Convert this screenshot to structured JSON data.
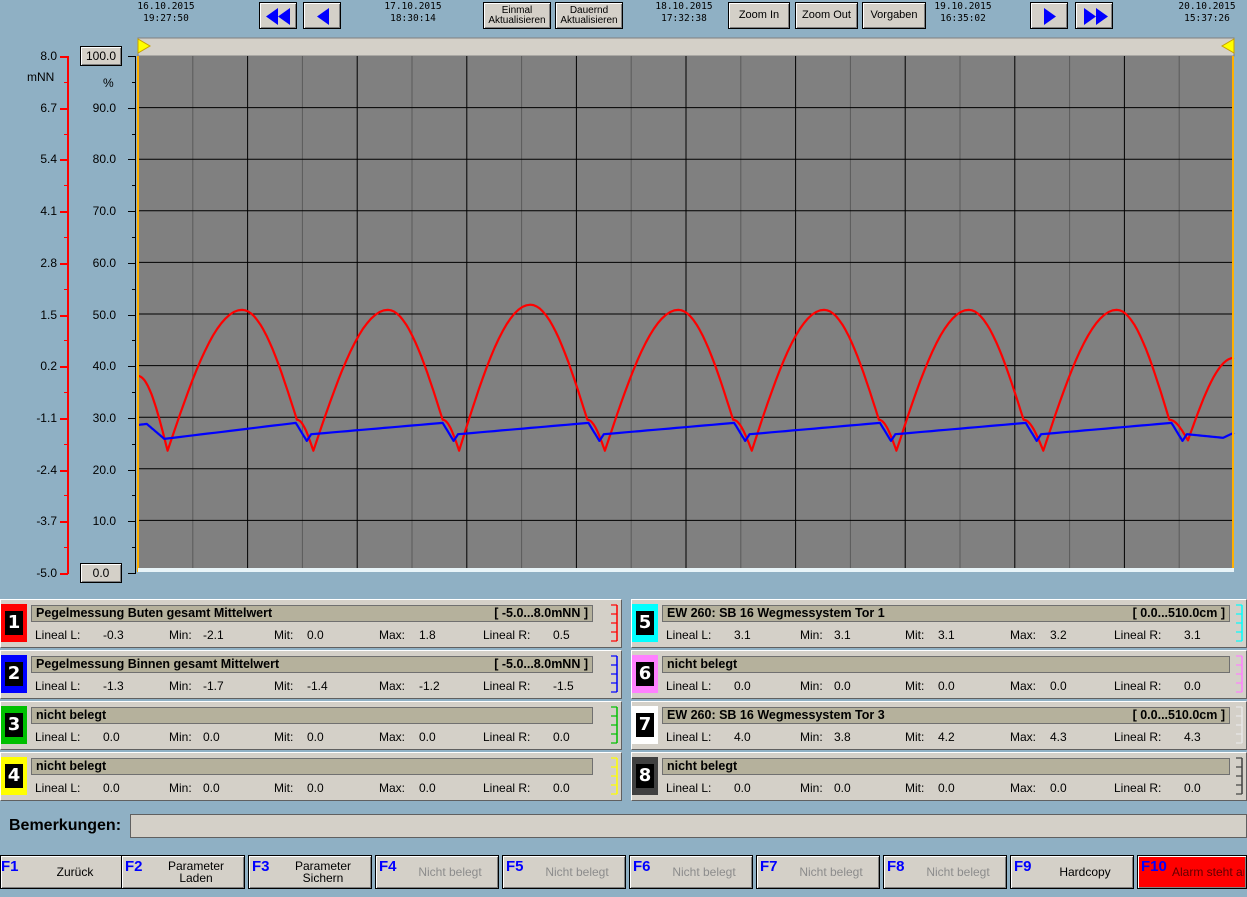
{
  "timeline": [
    {
      "date": "16.10.2015",
      "time": "19:27:50"
    },
    {
      "date": "17.10.2015",
      "time": "18:30:14"
    },
    {
      "date": "18.10.2015",
      "time": "17:32:38"
    },
    {
      "date": "19.10.2015",
      "time": "16:35:02"
    },
    {
      "date": "20.10.2015",
      "time": "15:37:26"
    }
  ],
  "toolbar": {
    "einmal": "Einmal\nAktualisieren",
    "dauernd": "Dauernd\nAktualisieren",
    "zoom_in": "Zoom In",
    "zoom_out": "Zoom Out",
    "vorgaben": "Vorgaben"
  },
  "left_axis": {
    "unit": "mNN",
    "ticks": [
      "8.0",
      "6.7",
      "5.4",
      "4.1",
      "2.8",
      "1.5",
      "0.2",
      "-1.1",
      "-2.4",
      "-3.7",
      "-5.0"
    ]
  },
  "pct_axis": {
    "unit": "%",
    "max_box": "100.0",
    "min_box": "0.0",
    "ticks": [
      "90.0",
      "80.0",
      "70.0",
      "60.0",
      "50.0",
      "40.0",
      "30.0",
      "20.0",
      "10.0"
    ]
  },
  "chart_data": {
    "type": "line",
    "xlim": [
      "16.10.2015 19:27:50",
      "20.10.2015 15:37:26"
    ],
    "ylim": [
      0,
      100
    ],
    "ylabel": "%",
    "grid": true,
    "series": [
      {
        "name": "Pegelmessung Buten gesamt Mittelwert",
        "color": "#ff0000",
        "x": [
          0,
          0.027,
          0.095,
          0.145,
          0.16,
          0.228,
          0.278,
          0.293,
          0.358,
          0.41,
          0.426,
          0.493,
          0.543,
          0.56,
          0.626,
          0.676,
          0.692,
          0.758,
          0.808,
          0.826,
          0.893,
          0.941,
          0.958,
          1.0
        ],
        "y": [
          38,
          23.5,
          50.8,
          29.5,
          23.5,
          50.8,
          29.5,
          23.5,
          51.8,
          29.5,
          23.5,
          50.8,
          29.5,
          23.5,
          50.8,
          29.5,
          23.5,
          50.8,
          29.5,
          23.5,
          50.8,
          29.5,
          25.5,
          41.5
        ]
      },
      {
        "name": "Pegelmessung Binnen gesamt Mittelwert",
        "color": "#0000ff",
        "x": [
          0,
          0.008,
          0.024,
          0.144,
          0.154,
          0.158,
          0.278,
          0.288,
          0.292,
          0.411,
          0.421,
          0.425,
          0.544,
          0.554,
          0.558,
          0.677,
          0.687,
          0.691,
          0.81,
          0.82,
          0.824,
          0.943,
          0.953,
          0.957,
          0.99,
          1.0
        ],
        "y": [
          28.5,
          28.7,
          25.8,
          28.9,
          25.4,
          26.7,
          28.9,
          25.4,
          26.7,
          28.9,
          25.4,
          26.7,
          28.9,
          25.4,
          26.7,
          28.9,
          25.4,
          26.7,
          28.9,
          25.4,
          26.7,
          28.9,
          25.4,
          26.7,
          26.0,
          27.0
        ]
      }
    ]
  },
  "channels": [
    {
      "num": "1",
      "color": "#ff0000",
      "name": "Pegelmessung Buten gesamt Mittelwert",
      "range": "[ -5.0...8.0mNN ]",
      "lineal_l": "-0.3",
      "min": "-2.1",
      "mit": "0.0",
      "max": "1.8",
      "lineal_r": "0.5"
    },
    {
      "num": "2",
      "color": "#0000ff",
      "name": "Pegelmessung Binnen gesamt Mittelwert",
      "range": "[ -5.0...8.0mNN ]",
      "lineal_l": "-1.3",
      "min": "-1.7",
      "mit": "-1.4",
      "max": "-1.2",
      "lineal_r": "-1.5"
    },
    {
      "num": "3",
      "color": "#00c000",
      "name": "nicht belegt",
      "range": "",
      "lineal_l": "0.0",
      "min": "0.0",
      "mit": "0.0",
      "max": "0.0",
      "lineal_r": "0.0"
    },
    {
      "num": "4",
      "color": "#ffff00",
      "name": "nicht belegt",
      "range": "",
      "lineal_l": "0.0",
      "min": "0.0",
      "mit": "0.0",
      "max": "0.0",
      "lineal_r": "0.0"
    },
    {
      "num": "5",
      "color": "#00ffff",
      "name": "EW 260: SB 16 Wegmessystem Tor 1",
      "range": "[ 0.0...510.0cm ]",
      "lineal_l": "3.1",
      "min": "3.1",
      "mit": "3.1",
      "max": "3.2",
      "lineal_r": "3.1"
    },
    {
      "num": "6",
      "color": "#ff80ff",
      "name": "nicht belegt",
      "range": "",
      "lineal_l": "0.0",
      "min": "0.0",
      "mit": "0.0",
      "max": "0.0",
      "lineal_r": "0.0"
    },
    {
      "num": "7",
      "color": "#ffffff",
      "name": "EW 260: SB 16 Wegmessystem Tor 3",
      "range": "[ 0.0...510.0cm ]",
      "lineal_l": "4.0",
      "min": "3.8",
      "mit": "4.2",
      "max": "4.3",
      "lineal_r": "4.3"
    },
    {
      "num": "8",
      "color": "#404040",
      "name": "nicht belegt",
      "range": "",
      "lineal_l": "0.0",
      "min": "0.0",
      "mit": "0.0",
      "max": "0.0",
      "lineal_r": "0.0"
    }
  ],
  "stat_labels": {
    "lineal_l": "Lineal L:",
    "min": "Min:",
    "mit": "Mit:",
    "max": "Max:",
    "lineal_r": "Lineal R:"
  },
  "remarks": {
    "label": "Bemerkungen:",
    "value": ""
  },
  "fkeys": [
    {
      "key": "F1",
      "label": "Zurück",
      "enabled": true
    },
    {
      "key": "F2",
      "label": "Parameter\nLaden",
      "enabled": true
    },
    {
      "key": "F3",
      "label": "Parameter\nSichern",
      "enabled": true
    },
    {
      "key": "F4",
      "label": "Nicht belegt",
      "enabled": false
    },
    {
      "key": "F5",
      "label": "Nicht belegt",
      "enabled": false
    },
    {
      "key": "F6",
      "label": "Nicht belegt",
      "enabled": false
    },
    {
      "key": "F7",
      "label": "Nicht belegt",
      "enabled": false
    },
    {
      "key": "F8",
      "label": "Nicht belegt",
      "enabled": false
    },
    {
      "key": "F9",
      "label": "Hardcopy",
      "enabled": true
    },
    {
      "key": "F10",
      "label": "Alarm steht an",
      "enabled": true
    }
  ],
  "colors": {
    "background": "#8fb0c4",
    "plot": "#808080",
    "alarm": "#ff0000"
  }
}
